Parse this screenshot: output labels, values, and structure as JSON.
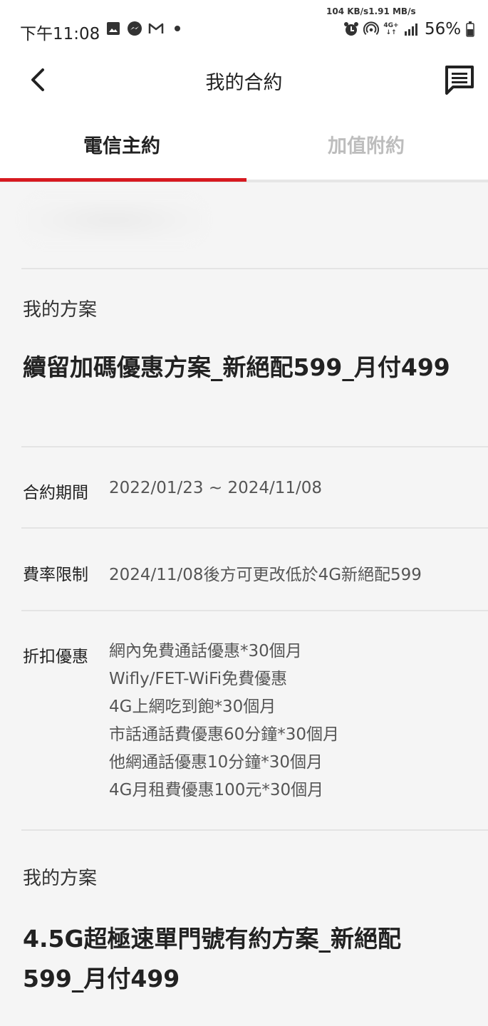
{
  "status_bar": {
    "time": "下午11:08",
    "net_speed": "104 KB/s1.91 MB/s",
    "network": "4G+",
    "battery": "56%",
    "left_icons": [
      "image-icon",
      "messenger-icon",
      "gmail-icon",
      "dot-icon"
    ],
    "right_icons": [
      "alarm-icon",
      "hotspot-icon",
      "network-4g-icon",
      "signal-icon",
      "battery-icon"
    ]
  },
  "header": {
    "title": "我的合約",
    "back_icon": "chevron-left-icon",
    "action_icon": "chat-icon"
  },
  "tabs": [
    {
      "label": "電信主約",
      "active": true
    },
    {
      "label": "加值附約",
      "active": false
    }
  ],
  "accent_color": "#d71920",
  "plans": [
    {
      "section_label": "我的方案",
      "name": "續留加碼優惠方案_新絕配599_月付499"
    },
    {
      "section_label": "我的方案",
      "name": "4.5G超極速單門號有約方案_新絕配599_月付499"
    }
  ],
  "contract": {
    "period_label": "合約期間",
    "period_value": "2022/01/23 ~ 2024/11/08",
    "rate_label": "費率限制",
    "rate_value": "2024/11/08後方可更改低於4G新絕配599",
    "discount_label": "折扣優惠",
    "discounts": [
      "網內免費通話優惠*30個月",
      "Wifly/FET-WiFi免費優惠",
      "4G上網吃到飽*30個月",
      "市話通話費優惠60分鐘*30個月",
      "他網通話優惠10分鐘*30個月",
      "4G月租費優惠100元*30個月"
    ]
  }
}
